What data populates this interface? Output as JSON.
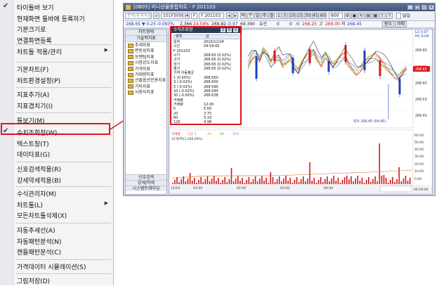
{
  "menu": {
    "items": [
      {
        "label": "타이틀바 보기",
        "checked": true,
        "submenu": false
      },
      {
        "label": "현재화면 툴바에 등록하기",
        "checked": false,
        "submenu": false
      },
      {
        "label": "기본크기로",
        "checked": false,
        "submenu": false
      },
      {
        "label": "연결화면등록",
        "checked": false,
        "submenu": false
      },
      {
        "label": "차트틀 적용/관리",
        "checked": false,
        "submenu": true
      },
      {
        "label": "기본차트(F)",
        "checked": false,
        "submenu": false
      },
      {
        "label": "차트환경설정(P)",
        "checked": false,
        "submenu": false
      },
      {
        "label": "지표추가(A)",
        "checked": false,
        "submenu": false
      },
      {
        "label": "지표겹치기(I)",
        "checked": false,
        "submenu": false
      },
      {
        "label": "툴보기(M)",
        "checked": false,
        "submenu": false
      },
      {
        "label": "수치조회창(W)",
        "checked": true,
        "submenu": false
      },
      {
        "label": "텍스트창(T)",
        "checked": false,
        "submenu": false
      },
      {
        "label": "데이타표(G)",
        "checked": false,
        "submenu": false
      },
      {
        "label": "신호검색적용(R)",
        "checked": false,
        "submenu": false
      },
      {
        "label": "강세약세적용(B)",
        "checked": false,
        "submenu": false
      },
      {
        "label": "수식관리자(M)",
        "checked": false,
        "submenu": false
      },
      {
        "label": "차트툴(L)",
        "checked": false,
        "submenu": true
      },
      {
        "label": "모든차트툴삭제(X)",
        "checked": false,
        "submenu": false
      },
      {
        "label": "자동추세선(A)",
        "checked": false,
        "submenu": false
      },
      {
        "label": "자동패턴분석(N)",
        "checked": false,
        "submenu": false
      },
      {
        "label": "캔들패턴분석(C)",
        "checked": false,
        "submenu": false
      },
      {
        "label": "가격데이터 시뮬레이션(S)",
        "checked": false,
        "submenu": false
      },
      {
        "label": "그림저장(D)",
        "checked": false,
        "submenu": false
      }
    ]
  },
  "window": {
    "title": "[0605] 미니선물종합차트 - F 201103",
    "toolbar": {
      "search_placeholder": "종목/투자자검색",
      "code": "101F3000",
      "type": "F",
      "name": "F 201103",
      "periods": [
        "분",
        "틱",
        "일",
        "주",
        "월"
      ],
      "minutes": [
        "1",
        "5",
        "10",
        "15",
        "30",
        "45",
        "60"
      ],
      "count": "120",
      "period_value": "600",
      "check_label": "달일"
    },
    "pricebar": [
      {
        "text": "268.65",
        "color": "#1b3fc0"
      },
      {
        "text": "▼ 0.25",
        "color": "#1b3fc0"
      },
      {
        "text": "-0.093%",
        "color": "#1b3fc0"
      },
      {
        "text": "2,366",
        "color": "#222"
      },
      {
        "text": "24.59%",
        "color": "#d01818"
      },
      {
        "text": "269.82",
        "color": "#222"
      },
      {
        "text": "-0.97",
        "color": "#1b3fc0"
      },
      {
        "text": "69.390",
        "color": "#222"
      },
      {
        "text": "유선",
        "color": "#222"
      },
      {
        "text": "0",
        "color": "#222"
      },
      {
        "text": "0",
        "color": "#222"
      },
      {
        "text": "시",
        "color": "#222"
      },
      {
        "text": "268.25",
        "color": "#d01818"
      },
      {
        "text": "고",
        "color": "#222"
      },
      {
        "text": "269.00",
        "color": "#d01818"
      },
      {
        "text": "저",
        "color": "#222"
      },
      {
        "text": "268.45",
        "color": "#1b3fc0"
      },
      {
        "text": "원수",
        "color": "#222"
      },
      {
        "text": "과매",
        "color": "#222"
      }
    ]
  },
  "left_panel": {
    "header1": "차트형태",
    "header2": "기술적지표",
    "items": [
      "추세지표",
      "변동성지표",
      "모멘텀지표",
      "시장강도지표",
      "가격지표",
      "거래량지표",
      "선물옵션전용지표",
      "기타지표",
      "사용자지표"
    ],
    "bottom_buttons": [
      "신호검색",
      "강세/약세",
      "시스템트레이딩"
    ]
  },
  "popup": {
    "title": "수치조회창",
    "btn1": "S",
    "btn2": "R",
    "table_header": {
      "k": "항목",
      "v": "값"
    },
    "rows": [
      {
        "k": "일자",
        "v": "2010/12/24"
      },
      {
        "k": "시간",
        "v": "04:59:00"
      },
      {
        "k": "F 201103",
        "v": ""
      },
      {
        "k": "시가",
        "v": "268.65 (0.02%)"
      },
      {
        "k": "고가",
        "v": "268.65 (0.02%)"
      },
      {
        "k": "저가",
        "v": "268.65 (0.02%)"
      },
      {
        "k": "종가",
        "v": "268.65 (0.02%)"
      },
      {
        "k": "가격 이동평균",
        "v": ""
      },
      {
        "k": "1 (0.00%)",
        "v": "268.650"
      },
      {
        "k": "3 (-0.02%)",
        "v": "268.600"
      },
      {
        "k": "5 (-0.02%)",
        "v": "268.590"
      },
      {
        "k": "10 (-0.02%)",
        "v": "268.590"
      },
      {
        "k": "30 (-0.00%)",
        "v": "268.638"
      },
      {
        "k": "거래량",
        "v": ""
      },
      {
        "k": "거래량",
        "v": "12.00"
      },
      {
        "k": "5",
        "v": "5.60"
      },
      {
        "k": "20",
        "v": "3.75"
      },
      {
        "k": "60",
        "v": "5.33"
      },
      {
        "k": "120",
        "v": "4.98"
      }
    ]
  },
  "chart": {
    "price_labels": [
      "LC-0.07",
      "HC-0.04",
      "268.80",
      "268.70",
      "268.65",
      "268.60",
      "268.50",
      "268.40"
    ],
    "last_price_tag": "268.65",
    "min_annotation": "최저 268.45 (04:45)",
    "volume_legend": [
      "가격량",
      "단순 5",
      "20",
      "60",
      "120"
    ],
    "volume_legend_colors": [
      "#d01818",
      "#e0641e",
      "#b3a21c",
      "#3aa54d",
      "#6f6fd0"
    ],
    "volume_sub": "12개(백)(1,200.00%)",
    "volume_labels": [
      "60.00",
      "50.00",
      "40.00",
      "30.00",
      "20.00",
      "10.00",
      "0.00"
    ],
    "x_labels": [
      "12/24",
      "01:00",
      "02:00",
      "03:00",
      "04:00"
    ],
    "time_tag": "04:59:00"
  }
}
